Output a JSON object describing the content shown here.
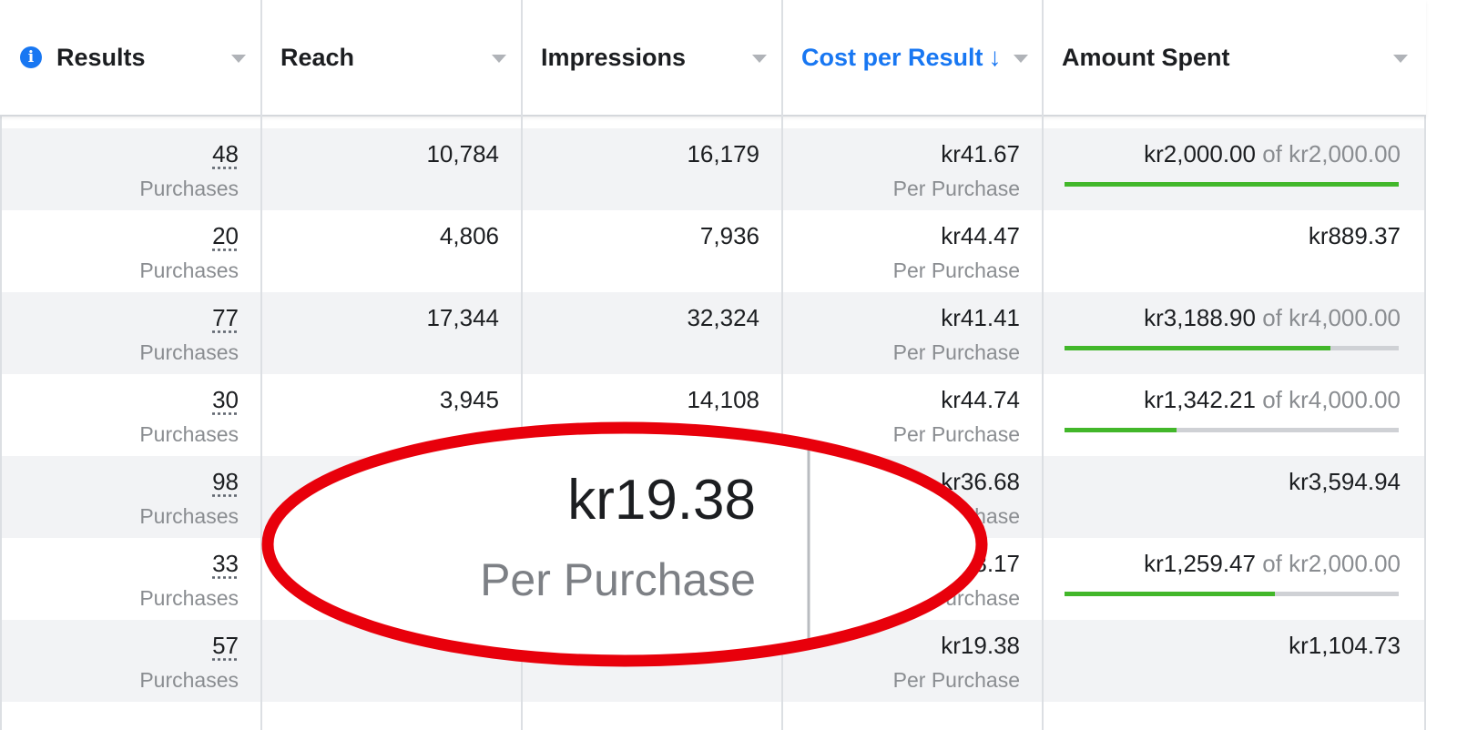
{
  "columns": [
    {
      "label": "Results",
      "active": false
    },
    {
      "label": "Reach",
      "active": false
    },
    {
      "label": "Impressions",
      "active": false
    },
    {
      "label": "Cost per Result",
      "active": true,
      "sort_glyph": "↓"
    },
    {
      "label": "Amount Spent",
      "active": false
    }
  ],
  "rows": [
    {
      "results": "48",
      "results_unit": "Purchases",
      "reach": "10,784",
      "impressions": "16,179",
      "cost": "kr41.67",
      "cost_unit": "Per Purchase",
      "spent": "kr2,000.00",
      "of_text": "of kr2,000.00",
      "progress": 1.0
    },
    {
      "results": "20",
      "results_unit": "Purchases",
      "reach": "4,806",
      "impressions": "7,936",
      "cost": "kr44.47",
      "cost_unit": "Per Purchase",
      "spent": "kr889.37",
      "of_text": "",
      "progress": null
    },
    {
      "results": "77",
      "results_unit": "Purchases",
      "reach": "17,344",
      "impressions": "32,324",
      "cost": "kr41.41",
      "cost_unit": "Per Purchase",
      "spent": "kr3,188.90",
      "of_text": "of kr4,000.00",
      "progress": 0.797
    },
    {
      "results": "30",
      "results_unit": "Purchases",
      "reach": "3,945",
      "impressions": "14,108",
      "cost": "kr44.74",
      "cost_unit": "Per Purchase",
      "spent": "kr1,342.21",
      "of_text": "of kr4,000.00",
      "progress": 0.336
    },
    {
      "results": "98",
      "results_unit": "Purchases",
      "reach": "",
      "impressions": "",
      "cost": "kr36.68",
      "cost_unit": "Per Purchase",
      "spent": "kr3,594.94",
      "of_text": "",
      "progress": null
    },
    {
      "results": "33",
      "results_unit": "Purchases",
      "reach": "",
      "impressions": "",
      "cost": "kr38.17",
      "cost_unit": "Per Purchase",
      "spent": "kr1,259.47",
      "of_text": "of kr2,000.00",
      "progress": 0.63
    },
    {
      "results": "57",
      "results_unit": "Purchases",
      "reach": "",
      "impressions": "",
      "cost": "kr19.38",
      "cost_unit": "Per Purchase",
      "spent": "kr1,104.73",
      "of_text": "",
      "progress": null
    }
  ],
  "zoom_callout": {
    "value": "kr19.38",
    "label": "Per Purchase"
  },
  "colors": {
    "accent": "#1877f2",
    "progress": "#42b72a",
    "highlight_ring": "#e8000b"
  },
  "icons": {
    "results_header": "info-icon",
    "column_menu": "caret-down-icon"
  }
}
